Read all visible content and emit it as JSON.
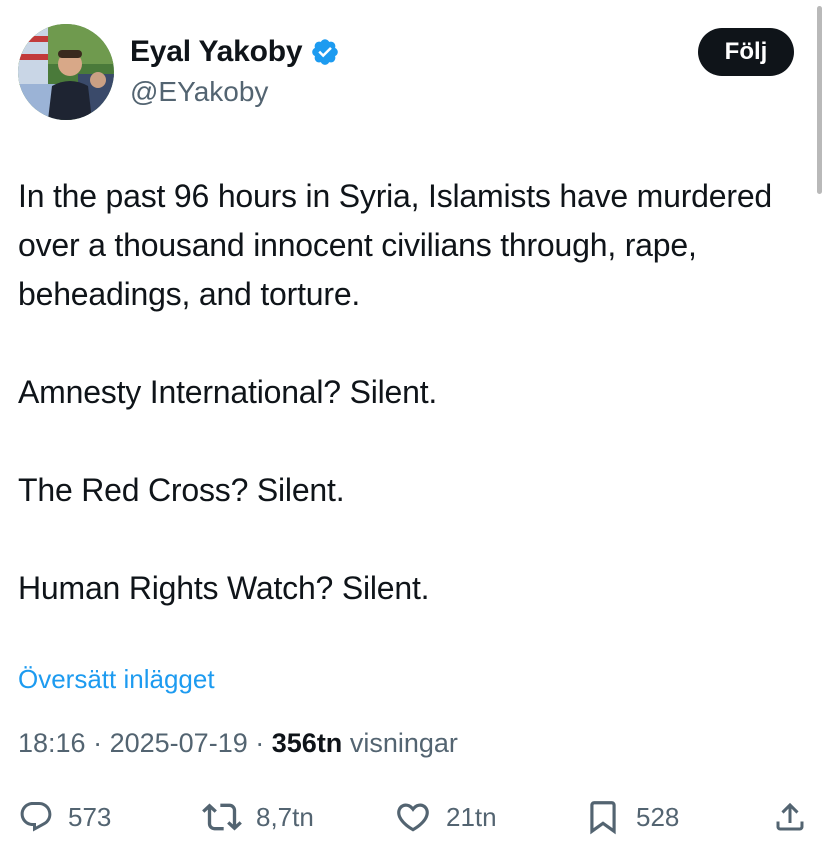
{
  "author": {
    "display_name": "Eyal Yakoby",
    "handle": "@EYakoby",
    "verified_icon": "verified-badge-icon",
    "avatar": "profile-photo"
  },
  "follow_button": {
    "label": "Följ"
  },
  "tweet": {
    "paragraphs": [
      "In the past 96 hours in Syria, Islamists have murdered over a thousand innocent civilians through, rape, beheadings, and torture.",
      "Amnesty International? Silent.",
      "The Red Cross? Silent.",
      "Human Rights Watch? Silent."
    ],
    "translate_label": "Översätt inlägget"
  },
  "meta": {
    "time": "18:16",
    "separator": "·",
    "date": "2025-07-19",
    "views_count": "356tn",
    "views_label": "visningar"
  },
  "actions": {
    "reply_count": "573",
    "retweet_count": "8,7tn",
    "like_count": "21tn",
    "bookmark_count": "528"
  },
  "colors": {
    "accent": "#1d9bf0",
    "text": "#0f1419",
    "muted": "#536471",
    "button_bg": "#0f1419"
  }
}
